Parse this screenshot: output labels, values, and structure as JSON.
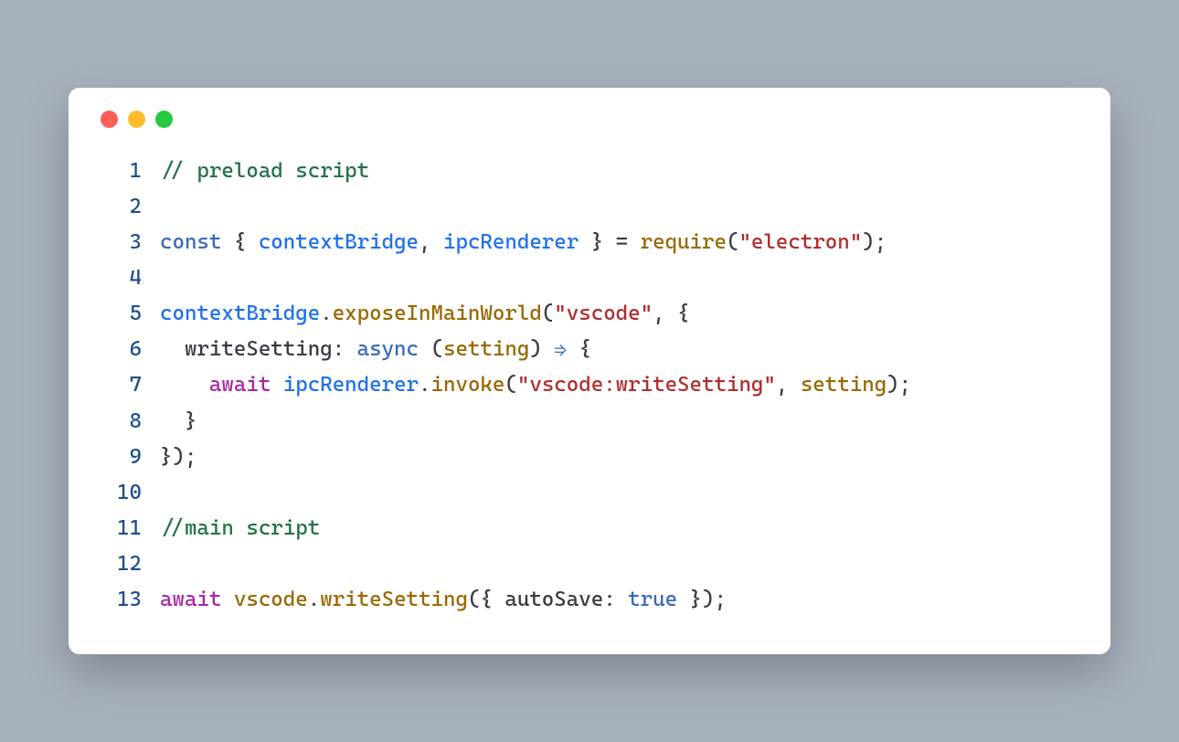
{
  "window": {
    "traffic_lights": {
      "red": "#ff5f56",
      "yellow": "#ffbd2e",
      "green": "#27c93f"
    }
  },
  "code": {
    "lines": [
      {
        "num": "1",
        "tokens": [
          {
            "t": "// preload script",
            "c": "c-comment"
          }
        ]
      },
      {
        "num": "2",
        "tokens": []
      },
      {
        "num": "3",
        "tokens": [
          {
            "t": "const",
            "c": "c-keyword"
          },
          {
            "t": " { ",
            "c": "c-punct"
          },
          {
            "t": "contextBridge",
            "c": "c-name"
          },
          {
            "t": ", ",
            "c": "c-punct"
          },
          {
            "t": "ipcRenderer",
            "c": "c-name"
          },
          {
            "t": " } = ",
            "c": "c-punct"
          },
          {
            "t": "require",
            "c": "c-func"
          },
          {
            "t": "(",
            "c": "c-punct"
          },
          {
            "t": "\"electron\"",
            "c": "c-string"
          },
          {
            "t": ");",
            "c": "c-punct"
          }
        ]
      },
      {
        "num": "4",
        "tokens": []
      },
      {
        "num": "5",
        "tokens": [
          {
            "t": "contextBridge",
            "c": "c-name"
          },
          {
            "t": ".",
            "c": "c-punct"
          },
          {
            "t": "exposeInMainWorld",
            "c": "c-func"
          },
          {
            "t": "(",
            "c": "c-punct"
          },
          {
            "t": "\"vscode\"",
            "c": "c-string"
          },
          {
            "t": ", {",
            "c": "c-punct"
          }
        ]
      },
      {
        "num": "6",
        "tokens": [
          {
            "t": "  ",
            "c": ""
          },
          {
            "t": "writeSetting",
            "c": "c-prop"
          },
          {
            "t": ": ",
            "c": "c-punct"
          },
          {
            "t": "async",
            "c": "c-keyword"
          },
          {
            "t": " (",
            "c": "c-punct"
          },
          {
            "t": "setting",
            "c": "c-var"
          },
          {
            "t": ") ",
            "c": "c-punct"
          },
          {
            "t": "⇒",
            "c": "c-keyword"
          },
          {
            "t": " {",
            "c": "c-punct"
          }
        ]
      },
      {
        "num": "7",
        "tokens": [
          {
            "t": "    ",
            "c": ""
          },
          {
            "t": "await",
            "c": "c-keyword2"
          },
          {
            "t": " ",
            "c": ""
          },
          {
            "t": "ipcRenderer",
            "c": "c-name"
          },
          {
            "t": ".",
            "c": "c-punct"
          },
          {
            "t": "invoke",
            "c": "c-func"
          },
          {
            "t": "(",
            "c": "c-punct"
          },
          {
            "t": "\"vscode:writeSetting\"",
            "c": "c-string"
          },
          {
            "t": ", ",
            "c": "c-punct"
          },
          {
            "t": "setting",
            "c": "c-var"
          },
          {
            "t": ");",
            "c": "c-punct"
          }
        ]
      },
      {
        "num": "8",
        "tokens": [
          {
            "t": "  }",
            "c": "c-punct"
          }
        ]
      },
      {
        "num": "9",
        "tokens": [
          {
            "t": "});",
            "c": "c-punct"
          }
        ]
      },
      {
        "num": "10",
        "tokens": []
      },
      {
        "num": "11",
        "tokens": [
          {
            "t": "//main script",
            "c": "c-comment"
          }
        ]
      },
      {
        "num": "12",
        "tokens": []
      },
      {
        "num": "13",
        "tokens": [
          {
            "t": "await",
            "c": "c-keyword2"
          },
          {
            "t": " ",
            "c": ""
          },
          {
            "t": "vscode",
            "c": "c-var"
          },
          {
            "t": ".",
            "c": "c-punct"
          },
          {
            "t": "writeSetting",
            "c": "c-func"
          },
          {
            "t": "({ ",
            "c": "c-punct"
          },
          {
            "t": "autoSave",
            "c": "c-prop"
          },
          {
            "t": ": ",
            "c": "c-punct"
          },
          {
            "t": "true",
            "c": "c-const"
          },
          {
            "t": " });",
            "c": "c-punct"
          }
        ]
      }
    ]
  }
}
